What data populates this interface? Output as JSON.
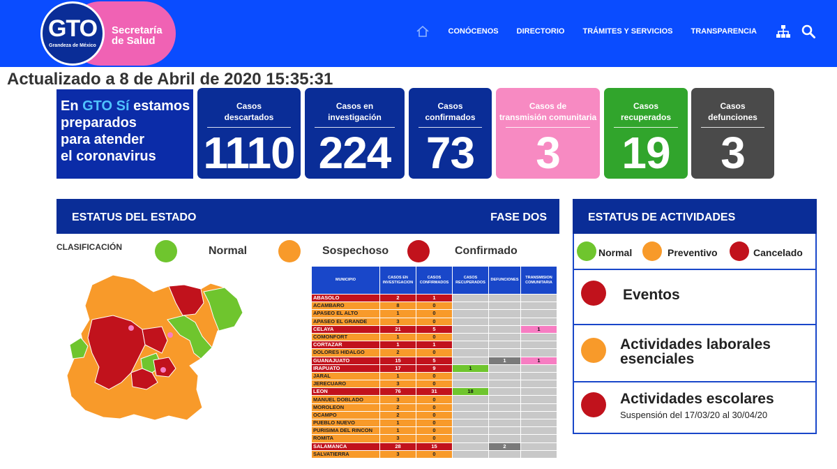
{
  "header": {
    "logo_text": "GTO",
    "logo_tagline": "Grandeza de México",
    "secretaria_line1": "Secretaría",
    "secretaria_line2": "de Salud",
    "nav": [
      "CONÓCENOS",
      "DIRECTORIO",
      "TRÁMITES Y SERVICIOS",
      "TRANSPARENCIA"
    ],
    "icons": [
      "home-icon",
      "sitemap-icon",
      "search-icon"
    ]
  },
  "updated": "Actualizado a 8 de Abril de 2020 15:35:31",
  "promo": {
    "line1_a": "En ",
    "line1_b": "GTO Sí",
    "line1_c": " estamos",
    "line2": "preparados",
    "line3": "para atender",
    "line4": "el coronavirus"
  },
  "cards": [
    {
      "label1": "Casos",
      "label2": "descartados",
      "value": "1110"
    },
    {
      "label1": "Casos en",
      "label2": "investigación",
      "value": "224"
    },
    {
      "label1": "Casos",
      "label2": "confirmados",
      "value": "73"
    },
    {
      "label1": "Casos de",
      "label2": "transmisión comunitaria",
      "value": "3"
    },
    {
      "label1": "Casos",
      "label2": "recuperados",
      "value": "19"
    },
    {
      "label1": "Casos",
      "label2": "defunciones",
      "value": "3"
    }
  ],
  "estado": {
    "title": "ESTATUS DEL ESTADO",
    "phase": "FASE DOS",
    "clasificacion": "CLASIFICACIÓN",
    "legend": [
      "Normal",
      "Sospechoso",
      "Confirmado"
    ]
  },
  "colors": {
    "header_blue": "#0a4cff",
    "navy": "#0a2d97",
    "green": "#6fc52e",
    "orange": "#f89a2a",
    "red": "#c1121c",
    "pink": "#f78ac2"
  },
  "table": {
    "headers": [
      "MUNICIPIO",
      "CASOS EN INVESTIGACION",
      "CASOS CONFIRMADOS",
      "CASOS RECUPERADOS",
      "DEFUNCIONES",
      "TRANSMISION COMUNITARIA"
    ],
    "rows": [
      {
        "status": "red",
        "cells": [
          "ABASOLO",
          "2",
          "1",
          "",
          "",
          ""
        ]
      },
      {
        "status": "orange",
        "cells": [
          "ACAMBARO",
          "8",
          "0",
          "",
          "",
          ""
        ]
      },
      {
        "status": "orange",
        "cells": [
          "APASEO EL ALTO",
          "1",
          "0",
          "",
          "",
          ""
        ]
      },
      {
        "status": "orange",
        "cells": [
          "APASEO EL GRANDE",
          "3",
          "0",
          "",
          "",
          ""
        ]
      },
      {
        "status": "red",
        "cells": [
          "CELAYA",
          "21",
          "5",
          "",
          "",
          "1"
        ]
      },
      {
        "status": "orange",
        "cells": [
          "COMONFORT",
          "1",
          "0",
          "",
          "",
          ""
        ]
      },
      {
        "status": "red",
        "cells": [
          "CORTAZAR",
          "1",
          "1",
          "",
          "",
          ""
        ]
      },
      {
        "status": "orange",
        "cells": [
          "DOLORES HIDALGO",
          "2",
          "0",
          "",
          "",
          ""
        ]
      },
      {
        "status": "red",
        "cells": [
          "GUANAJUATO",
          "15",
          "5",
          "",
          "1",
          "1"
        ]
      },
      {
        "status": "red",
        "cells": [
          "IRAPUATO",
          "17",
          "9",
          "1",
          "",
          ""
        ]
      },
      {
        "status": "orange",
        "cells": [
          "JARAL",
          "1",
          "0",
          "",
          "",
          ""
        ]
      },
      {
        "status": "orange",
        "cells": [
          "JERECUARO",
          "3",
          "0",
          "",
          "",
          ""
        ]
      },
      {
        "status": "red",
        "cells": [
          "LEON",
          "76",
          "31",
          "18",
          "",
          ""
        ]
      },
      {
        "status": "orange",
        "cells": [
          "MANUEL DOBLADO",
          "3",
          "0",
          "",
          "",
          ""
        ]
      },
      {
        "status": "orange",
        "cells": [
          "MOROLEON",
          "2",
          "0",
          "",
          "",
          ""
        ]
      },
      {
        "status": "orange",
        "cells": [
          "OCAMPO",
          "2",
          "0",
          "",
          "",
          ""
        ]
      },
      {
        "status": "orange",
        "cells": [
          "PUEBLO NUEVO",
          "1",
          "0",
          "",
          "",
          ""
        ]
      },
      {
        "status": "orange",
        "cells": [
          "PURISIMA DEL RINCON",
          "1",
          "0",
          "",
          "",
          ""
        ]
      },
      {
        "status": "orange",
        "cells": [
          "ROMITA",
          "3",
          "0",
          "",
          "",
          ""
        ]
      },
      {
        "status": "red",
        "cells": [
          "SALAMANCA",
          "28",
          "15",
          "",
          "2",
          ""
        ]
      },
      {
        "status": "orange",
        "cells": [
          "SALVATIERRA",
          "3",
          "0",
          "",
          "",
          ""
        ]
      }
    ]
  },
  "actividades": {
    "title": "ESTATUS DE ACTIVIDADES",
    "legend": [
      "Normal",
      "Preventivo",
      "Cancelado"
    ],
    "items": [
      {
        "line1": "Eventos",
        "line2": "",
        "sub": ""
      },
      {
        "line1": "Actividades laborales",
        "line2": "esenciales",
        "sub": ""
      },
      {
        "line1": "Actividades escolares",
        "line2": "",
        "sub": "Suspensión del 17/03/20 al 30/04/20"
      }
    ]
  }
}
